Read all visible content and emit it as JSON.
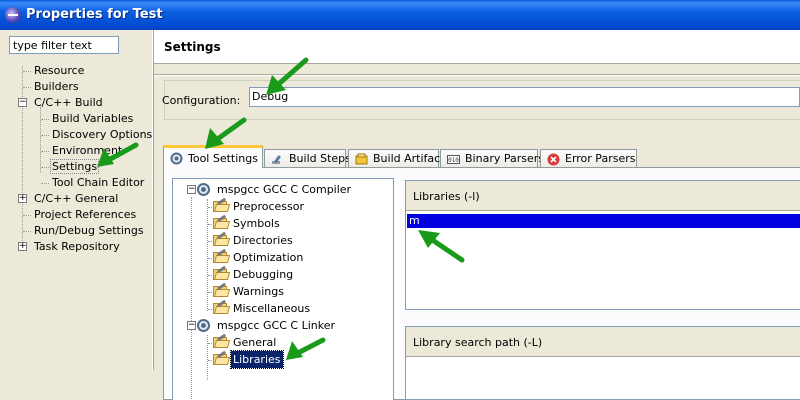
{
  "window": {
    "title": "Properties for Test"
  },
  "filter": {
    "placeholder": "type filter text"
  },
  "nav": {
    "items": [
      {
        "label": "Resource"
      },
      {
        "label": "Builders"
      },
      {
        "label": "C/C++ Build"
      },
      {
        "label": "Build Variables"
      },
      {
        "label": "Discovery Options"
      },
      {
        "label": "Environment"
      },
      {
        "label": "Settings"
      },
      {
        "label": "Tool Chain Editor"
      },
      {
        "label": "C/C++ General"
      },
      {
        "label": "Project References"
      },
      {
        "label": "Run/Debug Settings"
      },
      {
        "label": "Task Repository"
      }
    ],
    "expand_plus": "+",
    "expand_minus": "−"
  },
  "page": {
    "title": "Settings"
  },
  "configuration": {
    "label": "Configuration:",
    "value": "Debug"
  },
  "tabs": [
    {
      "label": "Tool Settings"
    },
    {
      "label": "Build Steps"
    },
    {
      "label": "Build Artifact"
    },
    {
      "label": "Binary Parsers"
    },
    {
      "label": "Error Parsers"
    }
  ],
  "tooltree": {
    "compiler": "mspgcc GCC C Compiler",
    "compiler_items": [
      "Preprocessor",
      "Symbols",
      "Directories",
      "Optimization",
      "Debugging",
      "Warnings",
      "Miscellaneous"
    ],
    "linker": "mspgcc GCC C Linker",
    "linker_items": [
      "General",
      "Libraries"
    ],
    "expand_minus": "−"
  },
  "libraries": {
    "header": "Libraries (-l)",
    "items": [
      "m"
    ]
  },
  "library_search_path": {
    "header": "Library search path (-L)"
  },
  "annotation": {
    "arrow_color": "#1a9a1a"
  }
}
